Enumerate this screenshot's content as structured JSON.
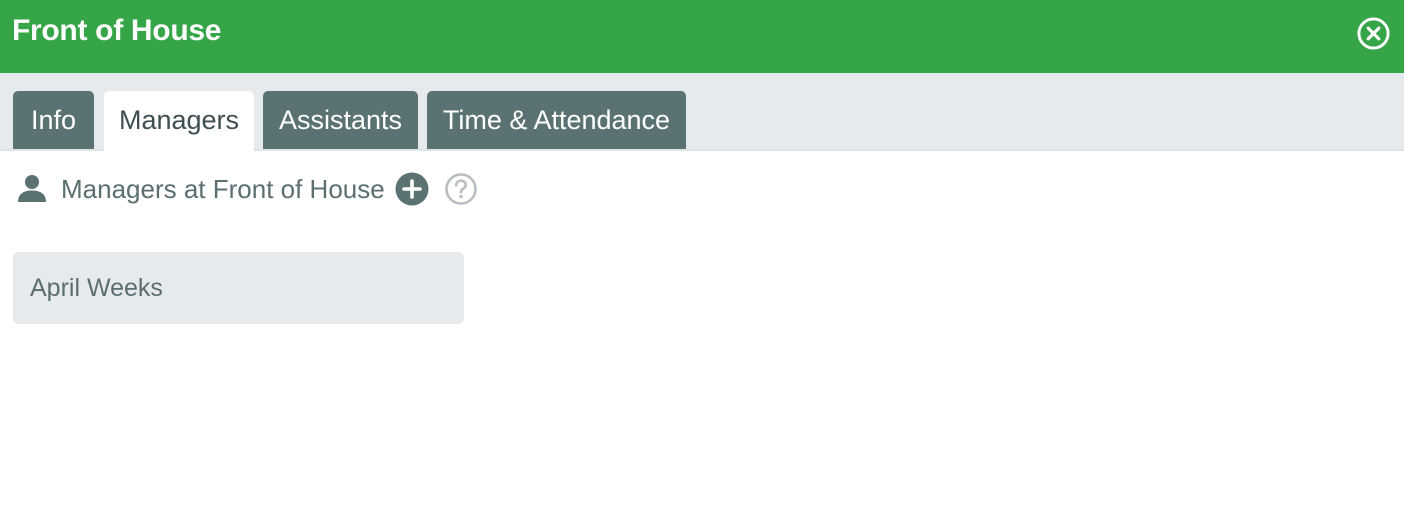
{
  "window": {
    "title": "Front of House",
    "close_icon": "close-circle-icon"
  },
  "colors": {
    "header": "#35a547",
    "tab_inactive": "#5b7272",
    "tab_bar": "#e7eaed",
    "text_muted": "#5b6e70"
  },
  "tabs": [
    {
      "label": "Info",
      "active": false
    },
    {
      "label": "Managers",
      "active": true
    },
    {
      "label": "Assistants",
      "active": false
    },
    {
      "label": "Time & Attendance",
      "active": false
    }
  ],
  "section": {
    "icon": "person-icon",
    "title": "Managers at Front of House",
    "add_icon": "add-circle-icon",
    "help_icon": "help-circle-icon"
  },
  "managers": [
    {
      "name": "April Weeks"
    }
  ]
}
